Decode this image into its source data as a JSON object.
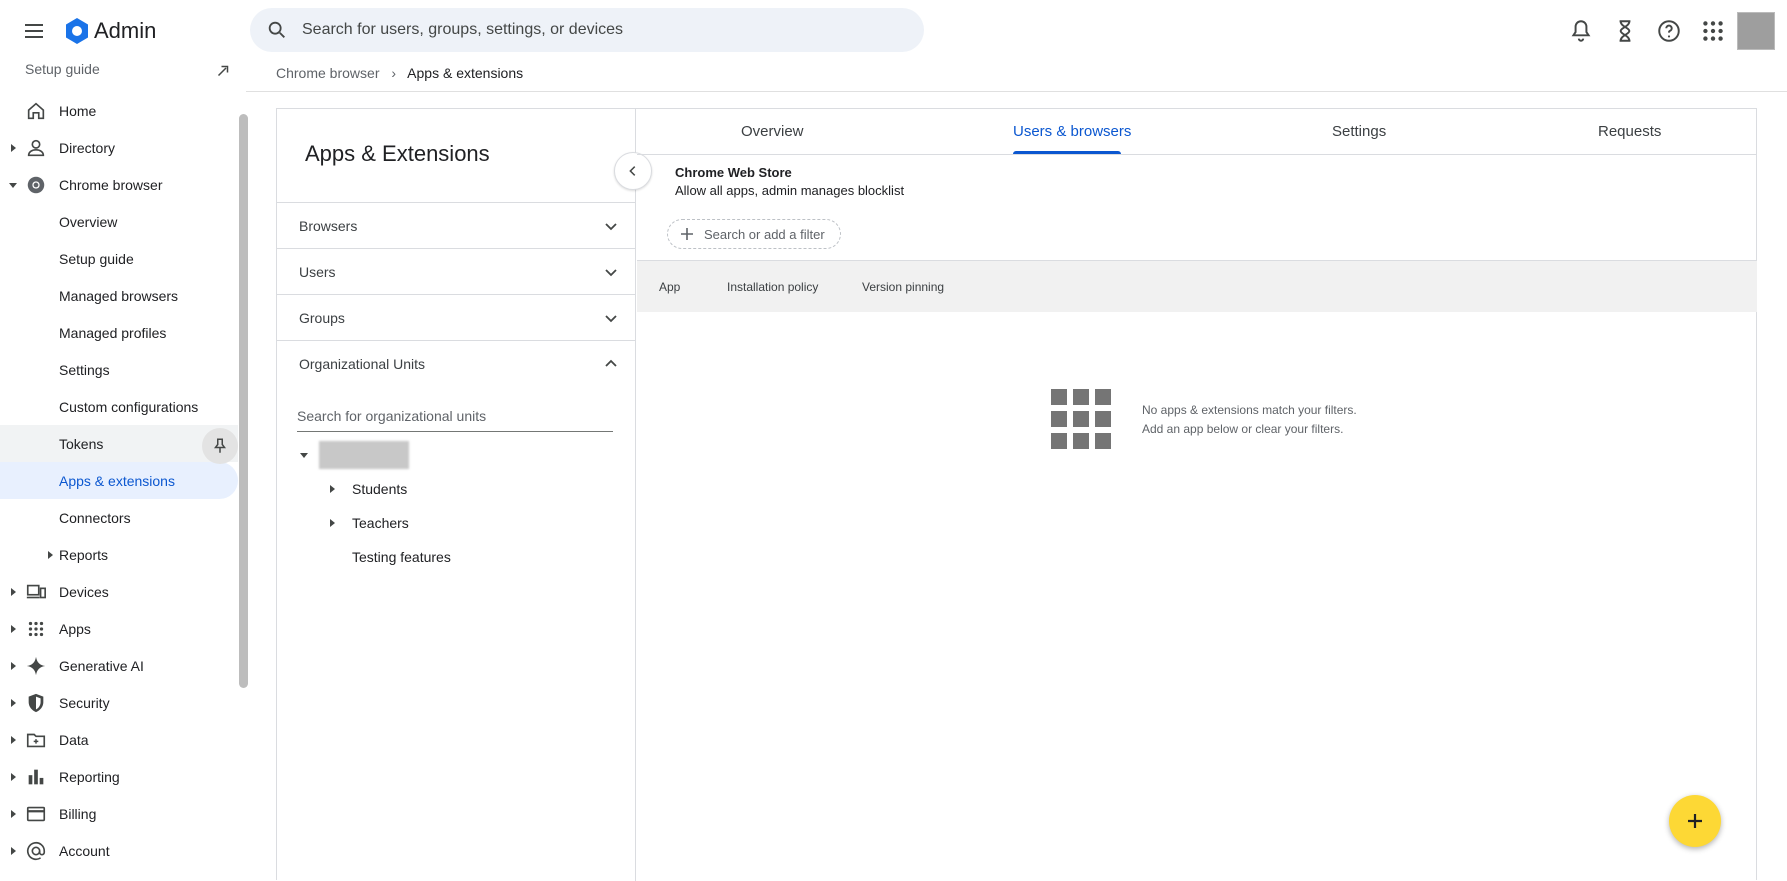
{
  "topbar": {
    "brand": "Admin",
    "search_placeholder": "Search for users, groups, settings, or devices",
    "icons": [
      "menu-icon",
      "notifications-icon",
      "hourglass-icon",
      "help-icon",
      "apps-grid-icon"
    ]
  },
  "sidebar": {
    "partial_label": "Setup guide",
    "items": [
      {
        "label": "Home",
        "icon": "home-icon"
      },
      {
        "label": "Directory",
        "icon": "person-icon"
      },
      {
        "label": "Chrome browser",
        "icon": "chrome-icon"
      },
      {
        "label": "Overview"
      },
      {
        "label": "Setup guide"
      },
      {
        "label": "Managed browsers"
      },
      {
        "label": "Managed profiles"
      },
      {
        "label": "Settings"
      },
      {
        "label": "Custom configurations"
      },
      {
        "label": "Tokens"
      },
      {
        "label": "Apps & extensions"
      },
      {
        "label": "Connectors"
      },
      {
        "label": "Reports"
      },
      {
        "label": "Devices",
        "icon": "devices-icon"
      },
      {
        "label": "Apps",
        "icon": "apps-icon"
      },
      {
        "label": "Generative AI",
        "icon": "sparkle-icon"
      },
      {
        "label": "Security",
        "icon": "shield-icon"
      },
      {
        "label": "Data",
        "icon": "data-folder-icon"
      },
      {
        "label": "Reporting",
        "icon": "bar-chart-icon"
      },
      {
        "label": "Billing",
        "icon": "credit-card-icon"
      },
      {
        "label": "Account",
        "icon": "at-icon"
      }
    ]
  },
  "breadcrumb": {
    "parent": "Chrome browser",
    "separator": "›",
    "current": "Apps & extensions"
  },
  "left_panel": {
    "title": "Apps & Extensions",
    "accordions": [
      "Browsers",
      "Users",
      "Groups",
      "Organizational Units"
    ],
    "ou_search_placeholder": "Search for organizational units",
    "tree": [
      "Students",
      "Teachers",
      "Testing features"
    ]
  },
  "tabs": [
    "Overview",
    "Users & browsers",
    "Settings",
    "Requests"
  ],
  "active_tab": "Users & browsers",
  "store": {
    "title": "Chrome Web Store",
    "subtitle": "Allow all apps, admin manages blocklist"
  },
  "filter": {
    "label": "Search or add a filter"
  },
  "table": {
    "columns": [
      "App",
      "Installation policy",
      "Version pinning"
    ]
  },
  "empty_state": {
    "line1": "No apps & extensions match your filters.",
    "line2": "Add an app below or clear your filters."
  },
  "colors": {
    "accent": "#0b57d0",
    "fab": "#fdd835",
    "active_bg": "#e8f0fe"
  }
}
